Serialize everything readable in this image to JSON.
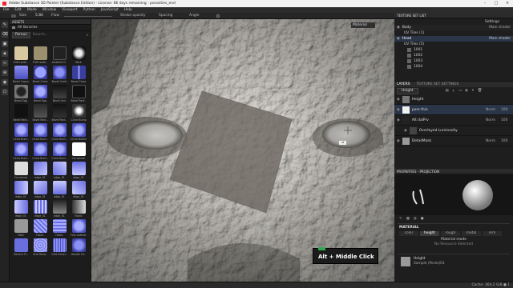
{
  "window": {
    "title": "Adobe Substance 3D Painter (Substance Edition) - License: 86 days remaining - porosities_end"
  },
  "menu": [
    "File",
    "Edit",
    "Mode",
    "Window",
    "Viewport",
    "Python",
    "JavaScript",
    "Help"
  ],
  "toolbar": {
    "size": "Size",
    "size_val": "5.84",
    "flow": "Flow",
    "stroke_opacity": "Stroke opacity",
    "spacing": "Spacing",
    "angle": "Angle"
  },
  "viewport": {
    "mode_select": "Material",
    "tooltip": "Alt + Middle Click",
    "cursor_label": "L8"
  },
  "assets": {
    "title": "ASSETS",
    "library": "All libraries",
    "filter": "Porous",
    "search_placeholder": "Search...",
    "items": [
      {
        "label": "Puff Leath.."
      },
      {
        "label": "Puff Leath.."
      },
      {
        "label": "Ambient O.."
      },
      {
        "label": "Bark"
      },
      {
        "label": "Bevel Capsu.."
      },
      {
        "label": "Bevel Circle"
      },
      {
        "label": "Bevel Circle"
      },
      {
        "label": "Bevel Cross"
      },
      {
        "label": "Bevel Egg"
      },
      {
        "label": "Bevel Egg"
      },
      {
        "label": "Bevel Line"
      },
      {
        "label": "Bevel Rect.."
      },
      {
        "label": "Bevel Rect.."
      },
      {
        "label": "Bevel Rect.."
      },
      {
        "label": "Bevel Rect.."
      },
      {
        "label": "Circle Bump"
      },
      {
        "label": "Circle Bum.."
      },
      {
        "label": "Circle Bum.."
      },
      {
        "label": "Circle Bum.."
      },
      {
        "label": "Circle Button"
      },
      {
        "label": "Circle Bum.."
      },
      {
        "label": "Circle Bum.."
      },
      {
        "label": "Circle Bum.."
      },
      {
        "label": "Curvature"
      },
      {
        "label": "Curvature"
      },
      {
        "label": "edge_01"
      },
      {
        "label": "edge_01"
      },
      {
        "label": "edge_01"
      },
      {
        "label": "edge_01"
      },
      {
        "label": "edge_01"
      },
      {
        "label": "edge_01"
      },
      {
        "label": "edge_01"
      },
      {
        "label": "edge_01"
      },
      {
        "label": "edge_01"
      },
      {
        "label": "edge_01"
      },
      {
        "label": "Fabric"
      },
      {
        "label": "Fiber"
      },
      {
        "label": "Fabric"
      },
      {
        "label": "Fabric"
      },
      {
        "label": "Fine Leather"
      },
      {
        "label": "Generic Fl.."
      },
      {
        "label": "Grid Hexa.."
      },
      {
        "label": "Grid Chisel.."
      },
      {
        "label": "Handle Ch.."
      }
    ]
  },
  "texture_set_list": {
    "title": "TEXTURE SET LIST",
    "shader": "Settings",
    "sets": [
      {
        "name": "Body",
        "shader": "Main shader"
      },
      {
        "name": "UV Tiles (1)",
        "shader": ""
      },
      {
        "name": "Head",
        "shader": "Main shader"
      },
      {
        "name": "UV Tiles (5)",
        "shader": ""
      }
    ],
    "tiles": [
      "1001",
      "1002",
      "1003",
      "1004"
    ]
  },
  "layers": {
    "tab_layers": "LAYERS",
    "tab_settings": "TEXTURE SET SETTINGS",
    "channel": "Height",
    "items": [
      {
        "name": "Height",
        "blend": "",
        "opacity": ""
      },
      {
        "name": "pore thin",
        "blend": "Norm",
        "opacity": "100"
      },
      {
        "name": "Alt dalPrv",
        "blend": "Norm",
        "opacity": "100"
      },
      {
        "name": "Overlayed Luminosity",
        "blend": "",
        "opacity": ""
      },
      {
        "name": "DetailMask",
        "blend": "Norm",
        "opacity": "100"
      }
    ]
  },
  "properties": {
    "title": "PROPERTIES - PROJECTION",
    "section": "MATERIAL",
    "channels": [
      "color",
      "height",
      "rough",
      "metal",
      "nrm"
    ],
    "material_mode": "Material mode",
    "no_resource": "No Resource Selected",
    "height_label": "Height",
    "height_resource": "Sample (Pores)01"
  },
  "status": {
    "left": "",
    "right": "Cache: 364.2 GiB   ●   1"
  }
}
